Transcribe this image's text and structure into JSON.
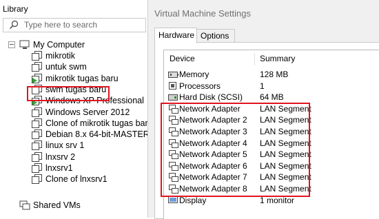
{
  "library": {
    "title": "Library",
    "search_placeholder": "Type here to search",
    "root": "My Computer",
    "vms": [
      {
        "name": "mikrotik",
        "running": false
      },
      {
        "name": "untuk swm",
        "running": false
      },
      {
        "name": "mikrotik tugas baru",
        "running": true
      },
      {
        "name": "swm tugas baru",
        "running": false,
        "selected": true
      },
      {
        "name": "Windows XP Professional",
        "running": true
      },
      {
        "name": "Windows Server 2012",
        "running": false
      },
      {
        "name": "Clone of mikrotik tugas baru",
        "running": false
      },
      {
        "name": "Debian 8.x 64-bit-MASTER",
        "running": false
      },
      {
        "name": "linux srv 1",
        "running": false
      },
      {
        "name": "lnxsrv 2",
        "running": false
      },
      {
        "name": "lnxsrv1",
        "running": false
      },
      {
        "name": "Clone of lnxsrv1",
        "running": false
      }
    ],
    "shared": "Shared VMs"
  },
  "settings": {
    "title": "Virtual Machine Settings",
    "tabs": [
      {
        "label": "Hardware",
        "active": true
      },
      {
        "label": "Options",
        "active": false
      }
    ],
    "columns": {
      "device": "Device",
      "summary": "Summary"
    },
    "hardware": [
      {
        "icon": "memory-icon",
        "device": "Memory",
        "summary": "128 MB"
      },
      {
        "icon": "processor-icon",
        "device": "Processors",
        "summary": "1"
      },
      {
        "icon": "hard-disk-icon",
        "device": "Hard Disk (SCSI)",
        "summary": "64 MB"
      },
      {
        "icon": "network-adapter-icon",
        "device": "Network Adapter",
        "summary": "LAN Segment"
      },
      {
        "icon": "network-adapter-icon",
        "device": "Network Adapter 2",
        "summary": "LAN Segment"
      },
      {
        "icon": "network-adapter-icon",
        "device": "Network Adapter 3",
        "summary": "LAN Segment"
      },
      {
        "icon": "network-adapter-icon",
        "device": "Network Adapter 4",
        "summary": "LAN Segment"
      },
      {
        "icon": "network-adapter-icon",
        "device": "Network Adapter 5",
        "summary": "LAN Segment"
      },
      {
        "icon": "network-adapter-icon",
        "device": "Network Adapter 6",
        "summary": "LAN Segment"
      },
      {
        "icon": "network-adapter-icon",
        "device": "Network Adapter 7",
        "summary": "LAN Segment"
      },
      {
        "icon": "network-adapter-icon",
        "device": "Network Adapter 8",
        "summary": "LAN Segment"
      },
      {
        "icon": "display-icon",
        "device": "Display",
        "summary": "1 monitor"
      }
    ]
  },
  "colors": {
    "highlight": "#e0141e",
    "running": "#31a531"
  }
}
